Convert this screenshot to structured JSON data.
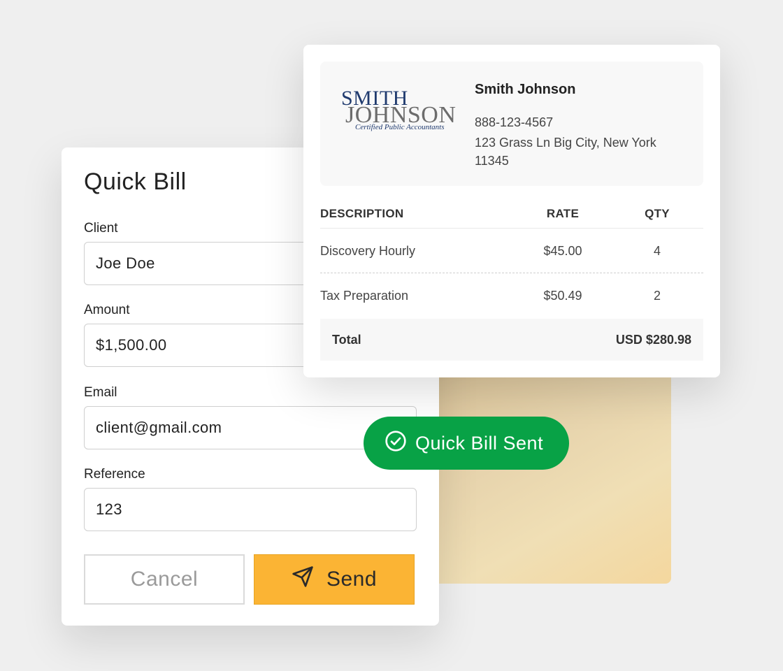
{
  "quick_bill": {
    "title": "Quick Bill",
    "fields": {
      "client": {
        "label": "Client",
        "value": "Joe Doe"
      },
      "amount": {
        "label": "Amount",
        "value": "$1,500.00"
      },
      "email": {
        "label": "Email",
        "value": "client@gmail.com"
      },
      "reference": {
        "label": "Reference",
        "value": "123"
      }
    },
    "cancel_label": "Cancel",
    "send_label": "Send",
    "send_color": "#fbb434"
  },
  "invoice": {
    "logo": {
      "line1": "SMITH",
      "line2": "JOHNSON",
      "tagline": "Certified Public Accountants"
    },
    "company_name": "Smith Johnson",
    "phone": "888-123-4567",
    "address": "123 Grass Ln Big City, New York 11345",
    "columns": {
      "description": "DESCRIPTION",
      "rate": "RATE",
      "qty": "QTY"
    },
    "rows": [
      {
        "description": "Discovery Hourly",
        "rate": "$45.00",
        "qty": "4"
      },
      {
        "description": "Tax Preparation",
        "rate": "$50.49",
        "qty": "2"
      }
    ],
    "total_label": "Total",
    "total_value": "USD $280.98"
  },
  "toast": {
    "text": "Quick Bill Sent",
    "icon": "check-circle-icon",
    "color": "#08a246"
  }
}
